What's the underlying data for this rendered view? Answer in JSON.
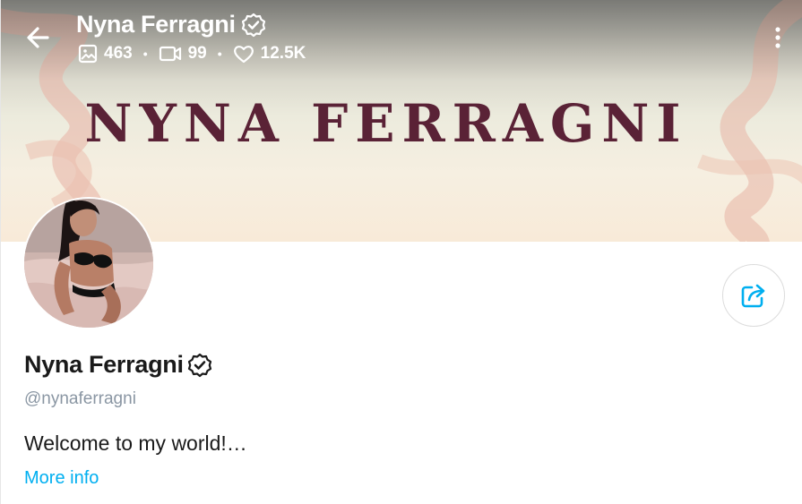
{
  "header": {
    "name": "Nyna Ferragni",
    "verified_icon": "verified-badge-icon",
    "stats": {
      "photos": "463",
      "videos": "99",
      "likes": "12.5K"
    },
    "icons": {
      "back": "arrow-left-icon",
      "photos": "image-icon",
      "videos": "video-camera-icon",
      "likes": "heart-icon",
      "more": "more-vertical-icon"
    }
  },
  "banner": {
    "text": "NYNA FERRAGNI"
  },
  "profile": {
    "name": "Nyna Ferragni",
    "username": "@nynaferragni",
    "bio": "Welcome to my world!…",
    "more_info_label": "More info",
    "share_icon": "share-icon"
  },
  "colors": {
    "accent": "#00aff0",
    "banner_text": "#5a2236",
    "muted_text": "#8a96a3"
  }
}
